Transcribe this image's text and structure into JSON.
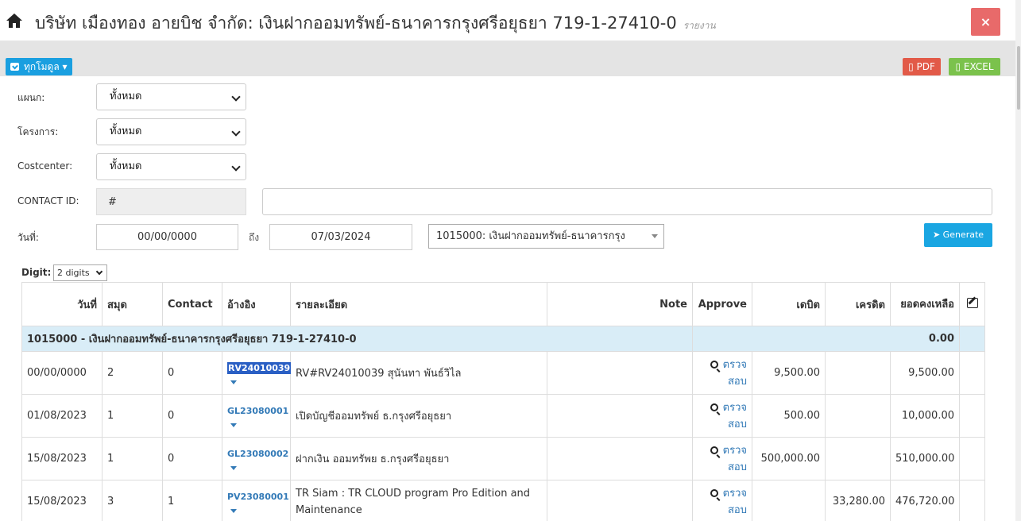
{
  "header": {
    "title": "บริษัท เมืองทอง อายบิช จำกัด: เงินฝากออมทรัพย์-ธนาคารกรุงศรีอยุธยา 719-1-27410-0",
    "subtitle": "รายงาน",
    "close_label": "×"
  },
  "toolbar": {
    "modules_label": "ทุกโมดูล",
    "pdf_label": "PDF",
    "excel_label": "EXCEL",
    "pdf_color": "#e25a48",
    "excel_color": "#7bc24c"
  },
  "filters": {
    "department_label": "แผนก:",
    "department_value": "ทั้งหมด",
    "project_label": "โครงการ:",
    "project_value": "ทั้งหมด",
    "costcenter_label": "Costcenter:",
    "costcenter_value": "ทั้งหมด",
    "contact_label": "CONTACT ID:",
    "contact_value": "#",
    "contact_name_value": "",
    "date_label": "วันที่:",
    "date_from": "00/00/0000",
    "to_label": "ถึง",
    "date_to": "07/03/2024",
    "account_value": "1015000: เงินฝากออมทรัพย์-ธนาคารกรุง",
    "generate_label": "Generate"
  },
  "digit": {
    "label": "Digit:",
    "value": "2 digits"
  },
  "table": {
    "columns": [
      "วันที่",
      "สมุด",
      "Contact",
      "อ้างอิง",
      "รายละเอียด",
      "Note",
      "Approve",
      "เดบิต",
      "เครดิต",
      "ยอดคงเหลือ"
    ],
    "group": {
      "label": "1015000 - เงินฝากออมทรัพย์-ธนาคารกรุงศรีอยุธยา 719-1-27410-0",
      "balance": "0.00"
    },
    "rows": [
      {
        "date": "00/00/0000",
        "book": "2",
        "contact": "0",
        "ref": "RV24010039",
        "detail": "RV#RV24010039 สุนันทา พันธ์วิไล",
        "note": "",
        "approve_line1": "ตรวจ",
        "approve_line2": "สอบ",
        "debit": "9,500.00",
        "credit": "",
        "balance": "9,500.00"
      },
      {
        "date": "01/08/2023",
        "book": "1",
        "contact": "0",
        "ref": "GL23080001",
        "detail": "เปิดบัญชีออมทรัพย์ ธ.กรุงศรีอยุธยา",
        "note": "",
        "approve_line1": "ตรวจ",
        "approve_line2": "สอบ",
        "debit": "500.00",
        "credit": "",
        "balance": "10,000.00"
      },
      {
        "date": "15/08/2023",
        "book": "1",
        "contact": "0",
        "ref": "GL23080002",
        "detail": "ฝากเงิน ออมทรัพย ธ.กรุงศรีอยุธยา",
        "note": "",
        "approve_line1": "ตรวจ",
        "approve_line2": "สอบ",
        "debit": "500,000.00",
        "credit": "",
        "balance": "510,000.00"
      },
      {
        "date": "15/08/2023",
        "book": "3",
        "contact": "1",
        "ref": "PV23080001",
        "detail": "TR Siam : TR CLOUD program Pro Edition and Maintenance",
        "note": "",
        "approve_line1": "ตรวจ",
        "approve_line2": "สอบ",
        "debit": "",
        "credit": "33,280.00",
        "balance": "476,720.00"
      }
    ]
  }
}
